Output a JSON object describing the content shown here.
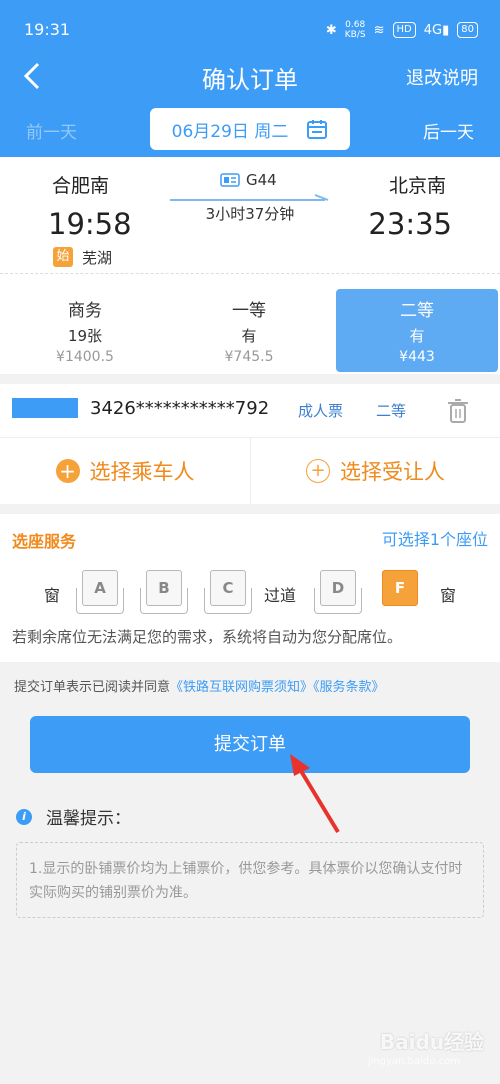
{
  "status": {
    "time": "19:31",
    "speed": "0.68",
    "speed_unit": "KB/S",
    "hd": "HD",
    "net": "4G",
    "battery": "80"
  },
  "nav": {
    "title": "确认订单",
    "right": "退改说明"
  },
  "date": {
    "prev": "前一天",
    "current": "06月29日 周二",
    "next": "后一天"
  },
  "trip": {
    "from_station": "合肥南",
    "from_time": "19:58",
    "start_badge": "始",
    "via": "芜湖",
    "train_no": "G44",
    "duration": "3小时37分钟",
    "to_station": "北京南",
    "to_time": "23:35"
  },
  "seats": [
    {
      "name": "商务",
      "avail": "19张",
      "price": "¥1400.5"
    },
    {
      "name": "一等",
      "avail": "有",
      "price": "¥745.5"
    },
    {
      "name": "二等",
      "avail": "有",
      "price": "¥443"
    }
  ],
  "passenger": {
    "id": "3426***********792",
    "ticket_type": "成人票",
    "seat": "二等"
  },
  "choose": {
    "passenger": "选择乘车人",
    "beneficiary": "选择受让人"
  },
  "seat_service": {
    "title": "选座服务",
    "hint": "可选择1个座位",
    "window": "窗",
    "aisle": "过道",
    "seat_a": "A",
    "seat_b": "B",
    "seat_c": "C",
    "seat_d": "D",
    "seat_f": "F",
    "note": "若剩余席位无法满足您的需求，系统将自动为您分配席位。"
  },
  "agree": {
    "prefix": "提交订单表示已阅读并同意",
    "link1": "《铁路互联网购票须知》",
    "link2": "《服务条款》"
  },
  "submit": "提交订单",
  "tips": {
    "title": "温馨提示：",
    "text": "1.显示的卧铺票价均为上铺票价，供您参考。具体票价以您确认支付时实际购买的铺别票价为准。"
  },
  "watermark": {
    "brand": "Baidu经验",
    "sub": "jingyan.baidu.com"
  },
  "colors": {
    "primary": "#3d9cf5",
    "accent": "#f5a23a"
  }
}
